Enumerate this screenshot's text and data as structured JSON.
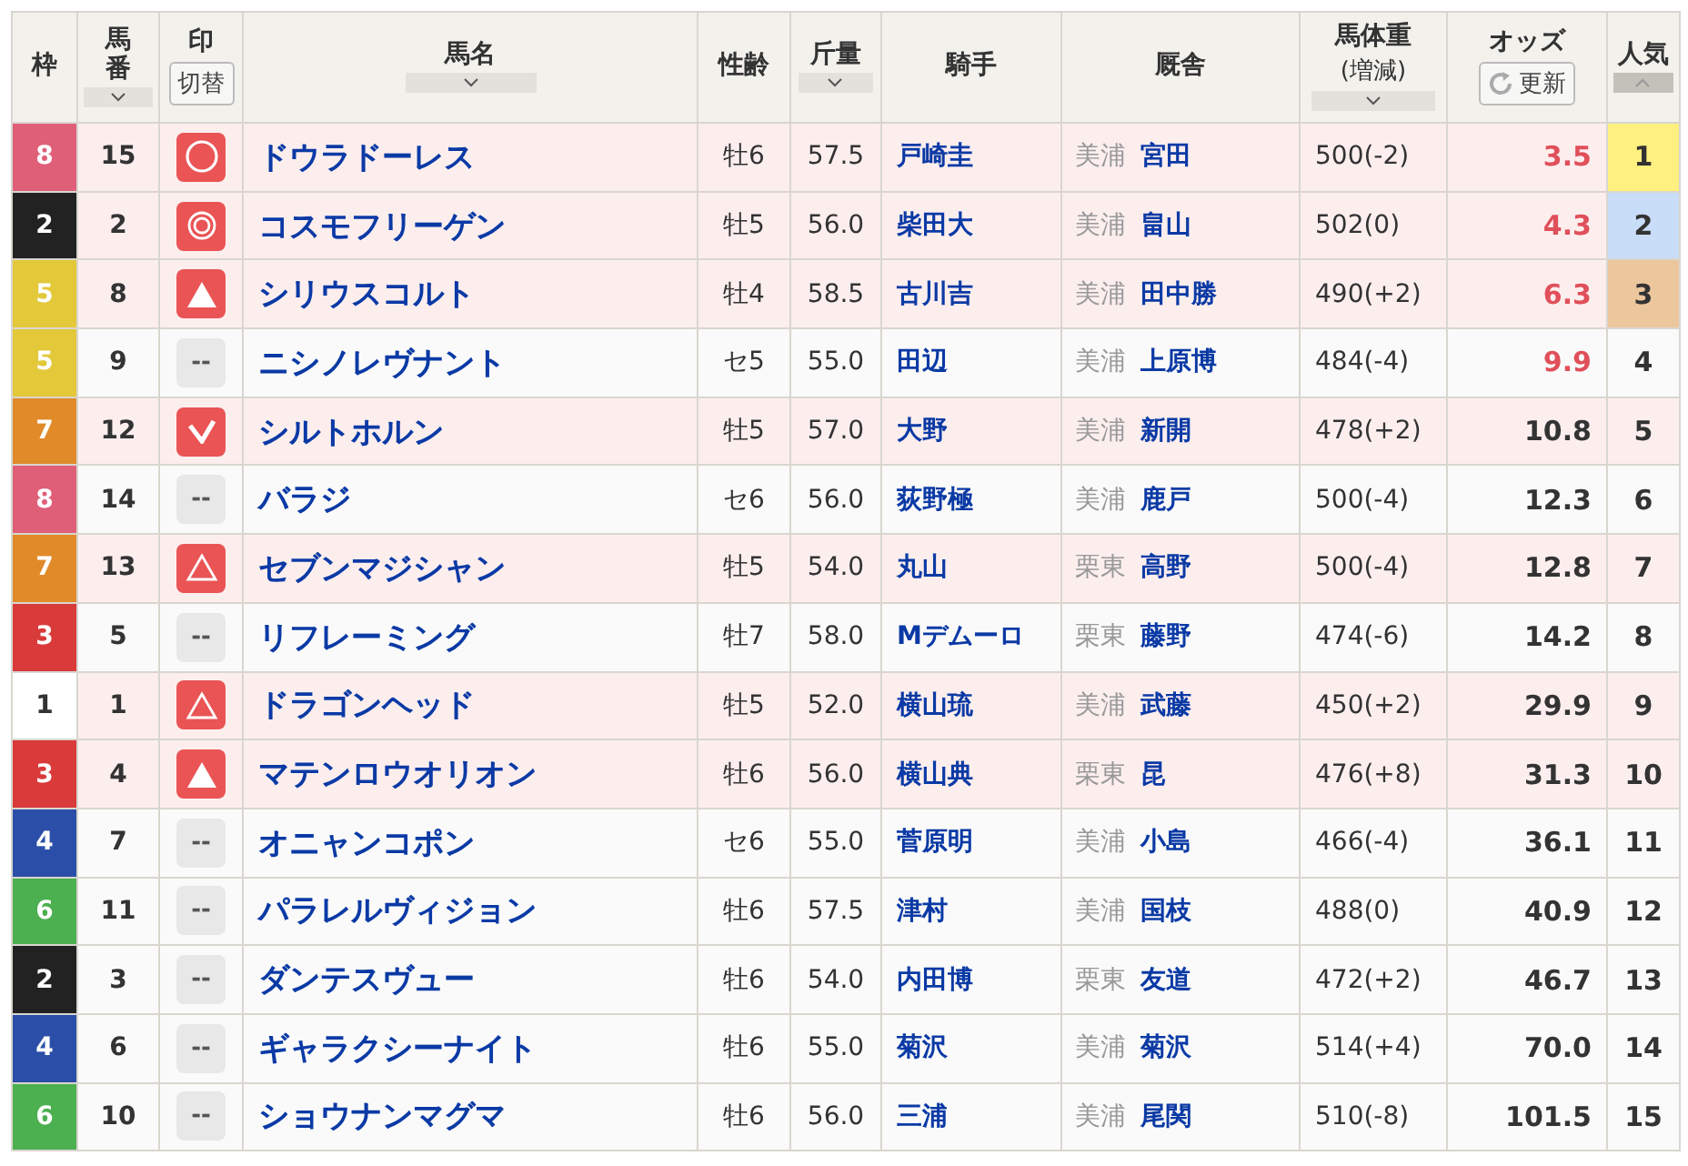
{
  "columns": [
    {
      "label": "枠"
    },
    {
      "label": "馬番",
      "sort_ascending": false,
      "selected": false
    },
    {
      "label": "印",
      "button": "切替"
    },
    {
      "label": "馬名",
      "sort_ascending": false,
      "selected": false
    },
    {
      "label": "性齢"
    },
    {
      "label": "斤量",
      "sort_ascending": false,
      "selected": false
    },
    {
      "label": "騎手"
    },
    {
      "label": "厩舎"
    },
    {
      "label": "馬体重",
      "sublabel": "(増減)",
      "sort_ascending": false,
      "selected": false
    },
    {
      "label": "オッズ",
      "button": "更新"
    },
    {
      "label": "人気",
      "sort_ascending": true,
      "selected": true
    }
  ],
  "rows": [
    {
      "frame": {
        "label": "8",
        "color": "#df5f78"
      },
      "number": "15",
      "mark": {
        "kind": "circle"
      },
      "name": "ドウラドーレス",
      "sex_age": "牡6",
      "weight": "57.5",
      "jockey": "戸崎圭",
      "region": "美浦",
      "trainer": "宮田",
      "body_weight": "500(-2)",
      "odds": "3.5",
      "favored": true,
      "rank": "1",
      "color": "#fff07f"
    },
    {
      "frame": {
        "label": "2",
        "color": "#222222"
      },
      "number": "2",
      "mark": {
        "kind": "double_circle"
      },
      "name": "コスモフリーゲン",
      "sex_age": "牡5",
      "weight": "56.0",
      "jockey": "柴田大",
      "region": "美浦",
      "trainer": "畠山",
      "body_weight": "502(0)",
      "odds": "4.3",
      "favored": true,
      "rank": "2",
      "color": "#c9dcf8"
    },
    {
      "frame": {
        "label": "5",
        "color": "#e3c83a"
      },
      "number": "8",
      "mark": {
        "kind": "filled_triangle"
      },
      "name": "シリウスコルト",
      "sex_age": "牡4",
      "weight": "58.5",
      "jockey": "古川吉",
      "region": "美浦",
      "trainer": "田中勝",
      "body_weight": "490(+2)",
      "odds": "6.3",
      "favored": true,
      "rank": "3",
      "color": "#ecc79e"
    },
    {
      "frame": {
        "label": "5",
        "color": "#e3c83a"
      },
      "number": "9",
      "mark": {
        "kind": "none",
        "text": "--"
      },
      "name": "ニシノレヴナント",
      "sex_age": "セ5",
      "weight": "55.0",
      "jockey": "田辺",
      "region": "美浦",
      "trainer": "上原博",
      "body_weight": "484(-4)",
      "odds": "9.9",
      "favored": true,
      "rank": "4"
    },
    {
      "frame": {
        "label": "7",
        "color": "#e08a2a"
      },
      "number": "12",
      "mark": {
        "kind": "check"
      },
      "name": "シルトホルン",
      "sex_age": "牡5",
      "weight": "57.0",
      "jockey": "大野",
      "region": "美浦",
      "trainer": "新開",
      "body_weight": "478(+2)",
      "odds": "10.8",
      "favored": false,
      "rank": "5"
    },
    {
      "frame": {
        "label": "8",
        "color": "#df5f78"
      },
      "number": "14",
      "mark": {
        "kind": "none",
        "text": "--"
      },
      "name": "バラジ",
      "sex_age": "セ6",
      "weight": "56.0",
      "jockey": "荻野極",
      "region": "美浦",
      "trainer": "鹿戸",
      "body_weight": "500(-4)",
      "odds": "12.3",
      "favored": false,
      "rank": "6"
    },
    {
      "frame": {
        "label": "7",
        "color": "#e08a2a"
      },
      "number": "13",
      "mark": {
        "kind": "triangle"
      },
      "name": "セブンマジシャン",
      "sex_age": "牡5",
      "weight": "54.0",
      "jockey": "丸山",
      "region": "栗東",
      "trainer": "高野",
      "body_weight": "500(-4)",
      "odds": "12.8",
      "favored": false,
      "rank": "7"
    },
    {
      "frame": {
        "label": "3",
        "color": "#d93a3a"
      },
      "number": "5",
      "mark": {
        "kind": "none",
        "text": "--"
      },
      "name": "リフレーミング",
      "sex_age": "牡7",
      "weight": "58.0",
      "jockey": "Mデムーロ",
      "region": "栗東",
      "trainer": "藤野",
      "body_weight": "474(-6)",
      "odds": "14.2",
      "favored": false,
      "rank": "8"
    },
    {
      "frame": {
        "label": "1",
        "color": "#ffffff"
      },
      "number": "1",
      "mark": {
        "kind": "triangle"
      },
      "name": "ドラゴンヘッド",
      "sex_age": "牡5",
      "weight": "52.0",
      "jockey": "横山琉",
      "region": "美浦",
      "trainer": "武藤",
      "body_weight": "450(+2)",
      "odds": "29.9",
      "favored": false,
      "rank": "9"
    },
    {
      "frame": {
        "label": "3",
        "color": "#d93a3a"
      },
      "number": "4",
      "mark": {
        "kind": "filled_triangle"
      },
      "name": "マテンロウオリオン",
      "sex_age": "牡6",
      "weight": "56.0",
      "jockey": "横山典",
      "region": "栗東",
      "trainer": "昆",
      "body_weight": "476(+8)",
      "odds": "31.3",
      "favored": false,
      "rank": "10"
    },
    {
      "frame": {
        "label": "4",
        "color": "#2b4fa8"
      },
      "number": "7",
      "mark": {
        "kind": "none",
        "text": "--"
      },
      "name": "オニャンコポン",
      "sex_age": "セ6",
      "weight": "55.0",
      "jockey": "菅原明",
      "region": "美浦",
      "trainer": "小島",
      "body_weight": "466(-4)",
      "odds": "36.1",
      "favored": false,
      "rank": "11"
    },
    {
      "frame": {
        "label": "6",
        "color": "#4caf50"
      },
      "number": "11",
      "mark": {
        "kind": "none",
        "text": "--"
      },
      "name": "パラレルヴィジョン",
      "sex_age": "牡6",
      "weight": "57.5",
      "jockey": "津村",
      "region": "美浦",
      "trainer": "国枝",
      "body_weight": "488(0)",
      "odds": "40.9",
      "favored": false,
      "rank": "12"
    },
    {
      "frame": {
        "label": "2",
        "color": "#222222"
      },
      "number": "3",
      "mark": {
        "kind": "none",
        "text": "--"
      },
      "name": "ダンテスヴュー",
      "sex_age": "牡6",
      "weight": "54.0",
      "jockey": "内田博",
      "region": "栗東",
      "trainer": "友道",
      "body_weight": "472(+2)",
      "odds": "46.7",
      "favored": false,
      "rank": "13"
    },
    {
      "frame": {
        "label": "4",
        "color": "#2b4fa8"
      },
      "number": "6",
      "mark": {
        "kind": "none",
        "text": "--"
      },
      "name": "ギャラクシーナイト",
      "sex_age": "牡6",
      "weight": "55.0",
      "jockey": "菊沢",
      "region": "美浦",
      "trainer": "菊沢",
      "body_weight": "514(+4)",
      "odds": "70.0",
      "favored": false,
      "rank": "14"
    },
    {
      "frame": {
        "label": "6",
        "color": "#4caf50"
      },
      "number": "10",
      "mark": {
        "kind": "none",
        "text": "--"
      },
      "name": "ショウナンマグマ",
      "sex_age": "牡6",
      "weight": "56.0",
      "jockey": "三浦",
      "region": "美浦",
      "trainer": "尾関",
      "body_weight": "510(-8)",
      "odds": "101.5",
      "favored": false,
      "rank": "15"
    }
  ]
}
